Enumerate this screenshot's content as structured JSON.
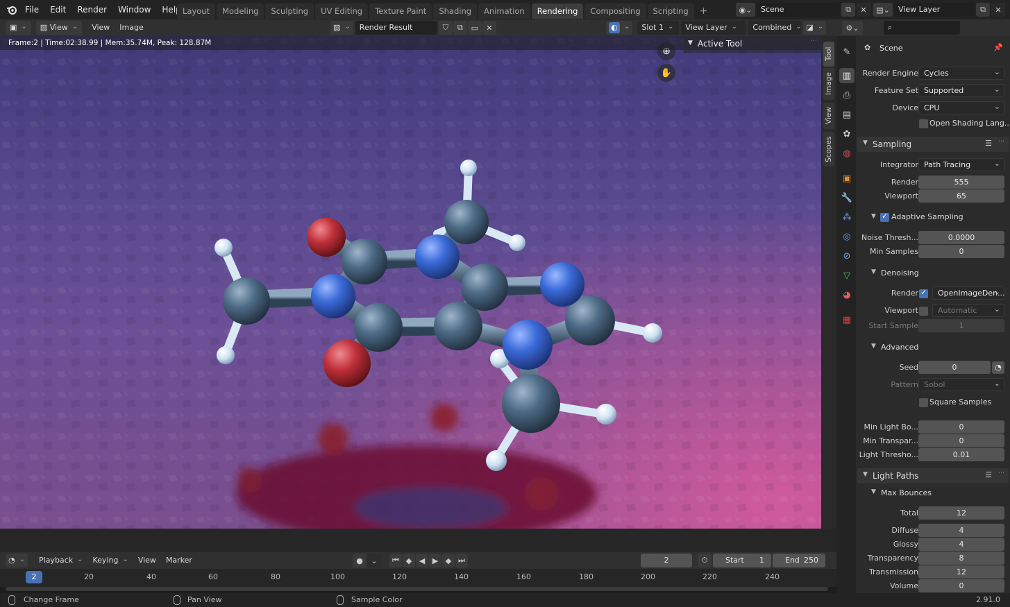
{
  "topbar": {
    "menus": [
      "File",
      "Edit",
      "Render",
      "Window",
      "Help"
    ],
    "workspaces": [
      "Layout",
      "Modeling",
      "Sculpting",
      "UV Editing",
      "Texture Paint",
      "Shading",
      "Animation",
      "Rendering",
      "Compositing",
      "Scripting"
    ],
    "active_workspace": "Rendering",
    "add_workspace": "+",
    "scene_name": "Scene",
    "view_layer_name": "View Layer"
  },
  "image_header": {
    "view_menu": "View",
    "menu_view": "View",
    "menu_image": "Image",
    "image_name": "Render Result",
    "slot": "Slot 1",
    "layer": "View Layer",
    "pass": "Combined"
  },
  "viewport": {
    "info": "Frame:2 | Time:02:38.99 | Mem:35.74M, Peak: 128.87M",
    "active_tool_label": "Active Tool",
    "side_tabs": [
      "Tool",
      "Image",
      "View",
      "Scopes"
    ]
  },
  "timeline": {
    "menus": [
      "Playback",
      "Keying",
      "View",
      "Marker"
    ],
    "current_frame": "2",
    "start_label": "Start",
    "start_value": "1",
    "end_label": "End",
    "end_value": "250",
    "ruler_ticks": [
      "20",
      "40",
      "60",
      "80",
      "100",
      "120",
      "140",
      "160",
      "180",
      "200",
      "220",
      "240"
    ],
    "playhead": "2"
  },
  "statusbar": {
    "hints": [
      "Change Frame",
      "Pan View",
      "Sample Color"
    ],
    "version": "2.91.0"
  },
  "properties": {
    "context": "Scene",
    "render_engine_label": "Render Engine",
    "render_engine": "Cycles",
    "feature_set_label": "Feature Set",
    "feature_set": "Supported",
    "device_label": "Device",
    "device": "CPU",
    "osl_label": "Open Shading Lang...",
    "sampling": {
      "title": "Sampling",
      "integrator_label": "Integrator",
      "integrator": "Path Tracing",
      "render_label": "Render",
      "render": "555",
      "viewport_label": "Viewport",
      "viewport": "65",
      "adaptive_label": "Adaptive Sampling",
      "noise_label": "Noise Thresh...",
      "noise": "0.0000",
      "min_samples_label": "Min Samples",
      "min_samples": "0",
      "denoising_title": "Denoising",
      "den_render_label": "Render",
      "den_render": "OpenImageDen...",
      "den_viewport_label": "Viewport",
      "den_viewport": "Automatic",
      "start_sample_label": "Start Sample",
      "start_sample": "1",
      "advanced_title": "Advanced",
      "seed_label": "Seed",
      "seed": "0",
      "pattern_label": "Pattern",
      "pattern": "Sobol",
      "square_label": "Square Samples",
      "min_light_label": "Min Light Bo...",
      "min_light": "0",
      "min_transp_label": "Min Transpar...",
      "min_transp": "0",
      "light_thresh_label": "Light Thresho...",
      "light_thresh": "0.01"
    },
    "light_paths": {
      "title": "Light Paths",
      "max_bounces_title": "Max Bounces",
      "total_label": "Total",
      "total": "12",
      "diffuse_label": "Diffuse",
      "diffuse": "4",
      "glossy_label": "Glossy",
      "glossy": "4",
      "transparency_label": "Transparency",
      "transparency": "8",
      "transmission_label": "Transmission",
      "transmission": "12",
      "volume_label": "Volume",
      "volume": "0"
    }
  },
  "colors": {
    "accent": "#4772b3",
    "carbon": "#4d6a85",
    "nitrogen": "#3a6ad8",
    "oxygen": "#c0303a",
    "hydrogen": "#d8e8f4"
  }
}
